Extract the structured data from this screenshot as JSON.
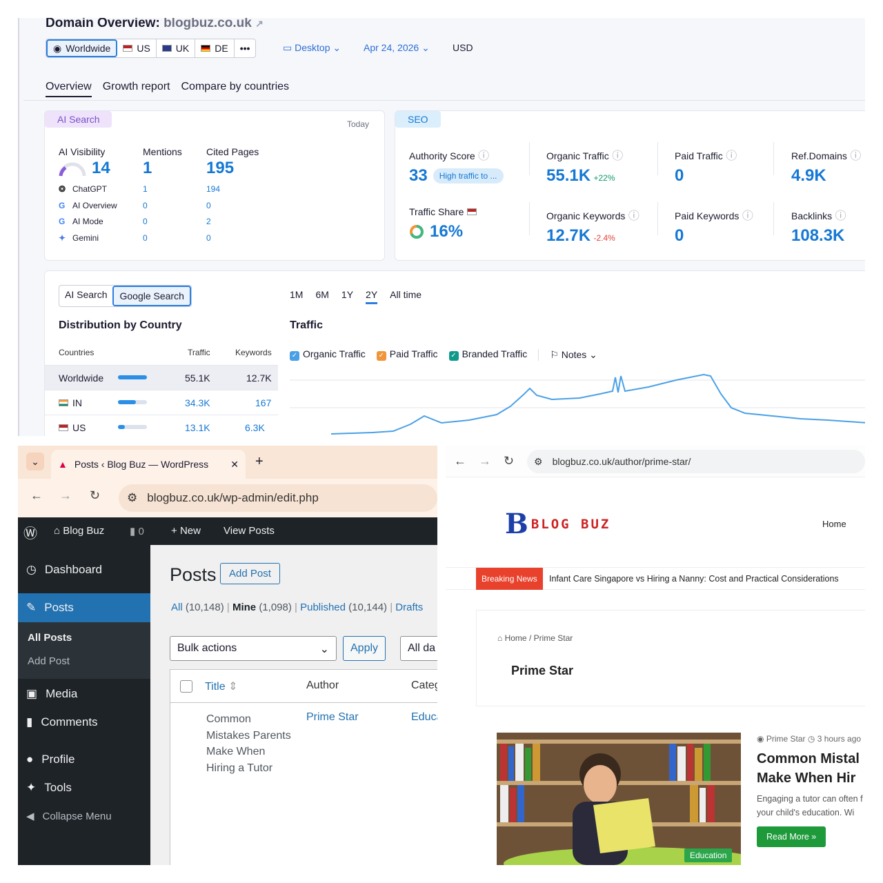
{
  "semrush": {
    "title_prefix": "Domain Overview:",
    "domain": "blogbuz.co.uk",
    "locations": [
      "Worldwide",
      "US",
      "UK",
      "DE",
      "•••"
    ],
    "device": "Desktop",
    "date": "Apr 24, 2026",
    "currency": "USD",
    "tabs": [
      "Overview",
      "Growth report",
      "Compare by countries"
    ],
    "ai": {
      "badge": "AI Search",
      "date": "Today",
      "col_vis": "AI Visibility",
      "col_mentions": "Mentions",
      "col_cited": "Cited Pages",
      "vis": "14",
      "mentions": "1",
      "cited": "195",
      "rows": [
        {
          "name": "ChatGPT",
          "icon": "chatgpt-icon",
          "m": "1",
          "c": "194"
        },
        {
          "name": "AI Overview",
          "icon": "google-icon",
          "m": "0",
          "c": "0"
        },
        {
          "name": "AI Mode",
          "icon": "google-icon",
          "m": "0",
          "c": "2"
        },
        {
          "name": "Gemini",
          "icon": "gemini-icon",
          "m": "0",
          "c": "0"
        }
      ]
    },
    "seo": {
      "badge": "SEO",
      "auth_lbl": "Authority Score",
      "auth_val": "33",
      "auth_badge": "High traffic to ...",
      "ot_lbl": "Organic Traffic",
      "ot_val": "55.1K",
      "ot_delta": "+22%",
      "pt_lbl": "Paid Traffic",
      "pt_val": "0",
      "rd_lbl": "Ref.Domains",
      "rd_val": "4.9K",
      "ts_lbl": "Traffic Share",
      "ts_val": "16%",
      "ok_lbl": "Organic Keywords",
      "ok_val": "12.7K",
      "ok_delta": "-2.4%",
      "pk_lbl": "Paid Keywords",
      "pk_val": "0",
      "bl_lbl": "Backlinks",
      "bl_val": "108.3K"
    },
    "dist": {
      "toggle": [
        "AI Search",
        "Google Search"
      ],
      "title": "Distribution by Country",
      "headers": [
        "Countries",
        "Traffic",
        "Keywords"
      ],
      "rows": [
        {
          "name": "Worldwide",
          "traffic": "55.1K",
          "kw": "12.7K",
          "share": 1.0
        },
        {
          "name": "IN",
          "traffic": "34.3K",
          "kw": "167",
          "share": 0.62
        },
        {
          "name": "US",
          "traffic": "13.1K",
          "kw": "6.3K",
          "share": 0.24
        }
      ]
    },
    "traffic": {
      "ranges": [
        "1M",
        "6M",
        "1Y",
        "2Y",
        "All time"
      ],
      "selected": "2Y",
      "title": "Traffic",
      "legend": [
        "Organic Traffic",
        "Paid Traffic",
        "Branded Traffic"
      ],
      "notes": "Notes",
      "colors": {
        "organic": "#4aa0e6",
        "paid": "#f0953a",
        "branded": "#0e9a8a"
      }
    }
  },
  "wp": {
    "tab_title": "Posts ‹ Blog Buz — WordPress",
    "url": "blogbuz.co.uk/wp-admin/edit.php",
    "site": "Blog Buz",
    "comments_count": "0",
    "new": "New",
    "view_posts": "View Posts",
    "menu": [
      "Dashboard",
      "Posts",
      "All Posts",
      "Add Post",
      "Media",
      "Comments",
      "Profile",
      "Tools",
      "Collapse Menu"
    ],
    "heading": "Posts",
    "add_btn": "Add Post",
    "filters": [
      {
        "label": "All",
        "count": "(10,148)"
      },
      {
        "label": "Mine",
        "count": "(1,098)"
      },
      {
        "label": "Published",
        "count": "(10,144)"
      },
      {
        "label": "Drafts",
        "count": ""
      }
    ],
    "bulk": "Bulk actions",
    "apply": "Apply",
    "dates": "All da",
    "cols": [
      "Title",
      "Author",
      "Categ"
    ],
    "post_title": "Common Mistakes Parents Make When Hiring a Tutor",
    "post_author": "Prime Star",
    "post_cat": "Educa"
  },
  "blog": {
    "url": "blogbuz.co.uk/author/prime-star/",
    "logo_text": "BLOG BUZ",
    "nav_home": "Home",
    "breaking_lbl": "Breaking News",
    "breaking": "Infant Care Singapore vs Hiring a Nanny: Cost and Practical Considerations",
    "crumb": "Home / Prime Star",
    "author": "Prime Star",
    "meta_author": "Prime Star",
    "meta_time": "3 hours ago",
    "article_title": "Common Mistal Make When Hir",
    "excerpt": "Engaging a tutor can often f in your child's education. Wi",
    "read_more": "Read More »",
    "category": "Education"
  }
}
